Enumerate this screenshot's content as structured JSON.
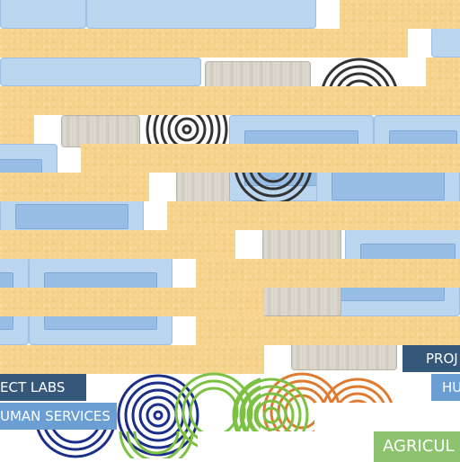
{
  "labels": {
    "labs": "ECT LABS",
    "human_services": "UMAN SERVICES",
    "projects": "PROJ",
    "human_short": "HU",
    "agriculture": "AGRICUL"
  },
  "icons": [
    "maze-icon",
    "maze-icon",
    "maze-icon",
    "maze-icon",
    "maze-icon",
    "maze-icon",
    "maze-icon"
  ],
  "colors": {
    "sand": "#f6d38b",
    "panel_light": "#bcd6ef",
    "panel_inner": "#97bde5",
    "bar_dark": "#35577a",
    "bar_light": "#6b9fd4",
    "bar_green": "#8dc26f",
    "maze_dark": "#333333",
    "maze_navy": "#1b2f8a",
    "maze_green": "#7cc142",
    "maze_orange": "#e07a2f"
  }
}
